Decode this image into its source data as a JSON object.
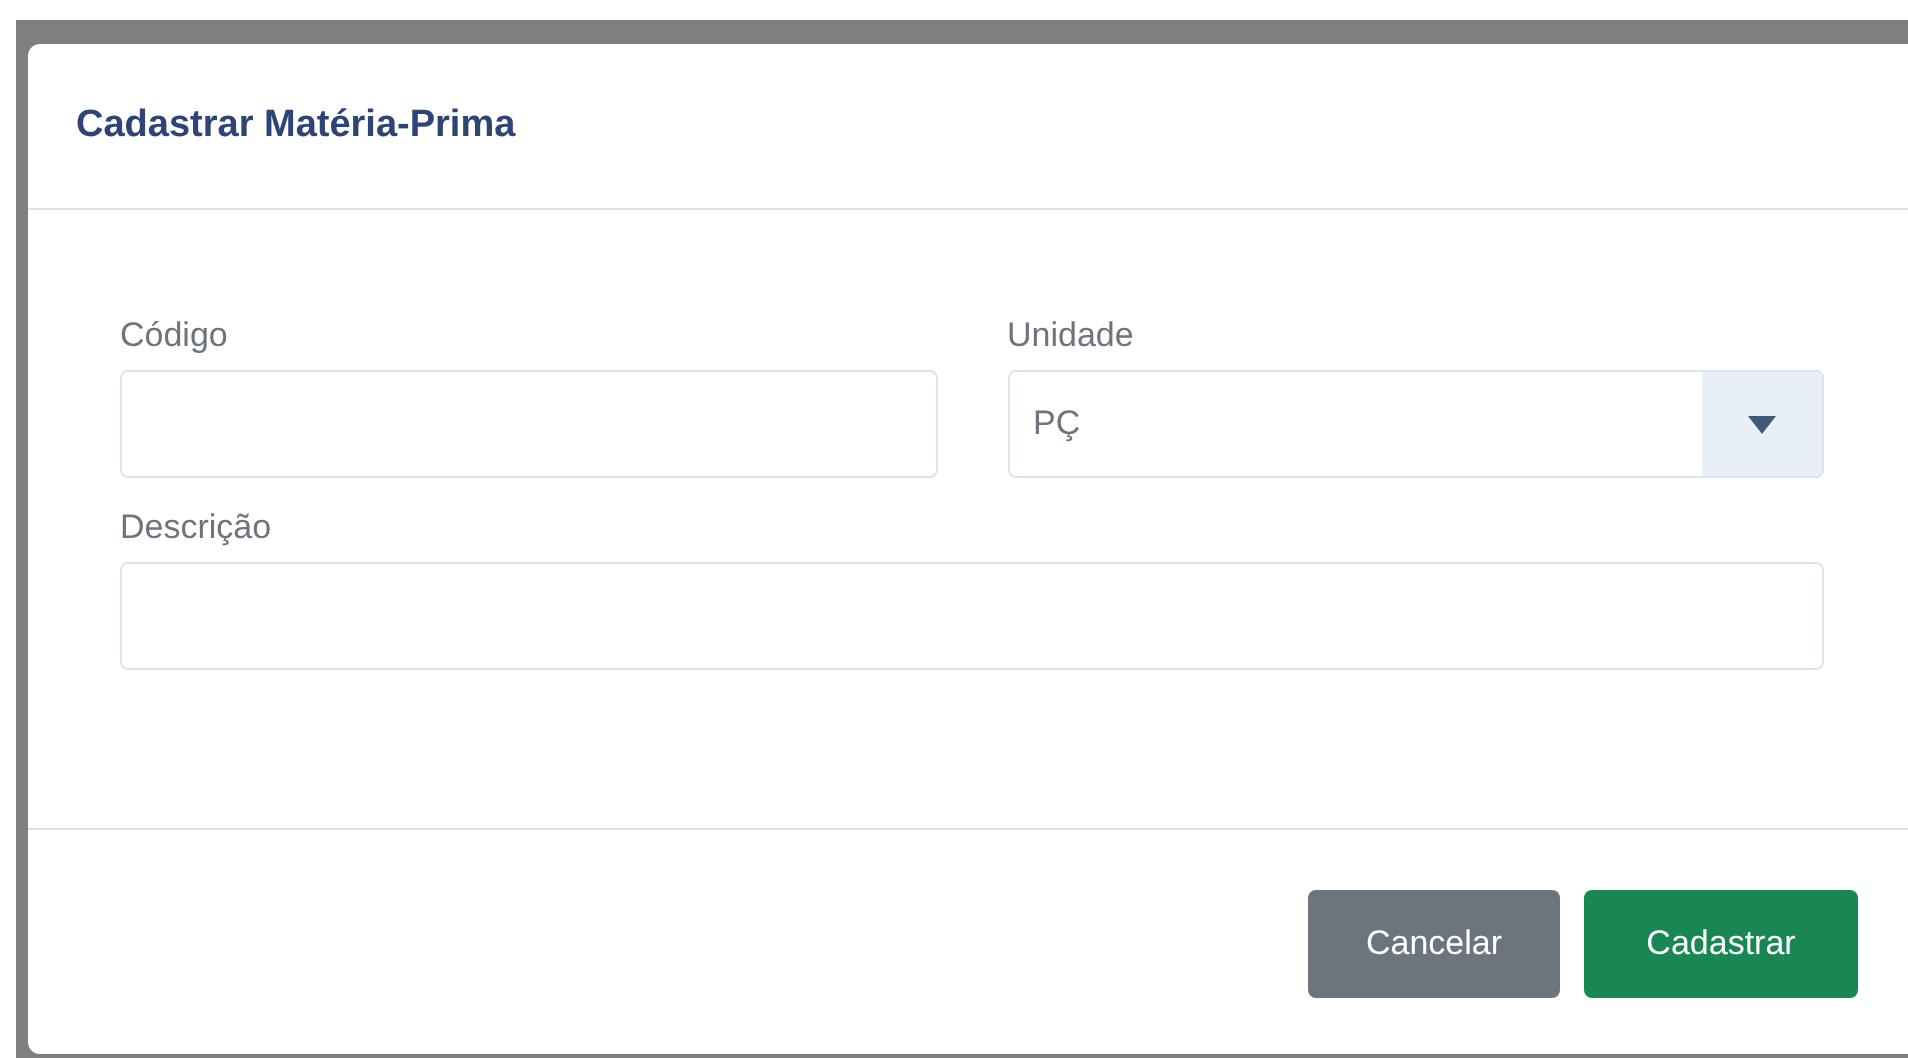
{
  "dialog": {
    "title": "Cadastrar Matéria-Prima",
    "fields": [
      {
        "kind": "text",
        "label": "Código"
      },
      {
        "kind": "select",
        "label": "Unidade",
        "value": "PÇ"
      },
      {
        "kind": "text",
        "label": "Descrição"
      }
    ],
    "buttons": [
      {
        "kind": "secondary",
        "label": "Cancelar"
      },
      {
        "kind": "primary",
        "label": "Cadastrar"
      }
    ]
  }
}
